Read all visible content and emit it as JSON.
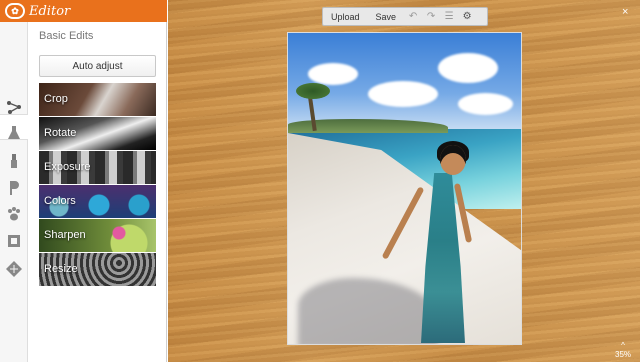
{
  "app": {
    "logo": "✿",
    "title": "Editor"
  },
  "panel": {
    "heading": "Basic Edits",
    "auto_adjust_label": "Auto adjust",
    "tools": [
      {
        "label": "Crop"
      },
      {
        "label": "Rotate"
      },
      {
        "label": "Exposure"
      },
      {
        "label": "Colors"
      },
      {
        "label": "Sharpen"
      },
      {
        "label": "Resize"
      }
    ]
  },
  "rail_icons": [
    "share-nodes-icon",
    "flask-icon",
    "lipstick-icon",
    "p-letter-icon",
    "paw-icon",
    "frame-icon",
    "texture-icon"
  ],
  "toolbar": {
    "upload_label": "Upload",
    "save_label": "Save"
  },
  "workspace": {
    "close_label": "×",
    "zoom_caret": "^",
    "zoom_level": "35%"
  },
  "colors": {
    "accent": "#e9711c",
    "wood": "#cf944c"
  }
}
